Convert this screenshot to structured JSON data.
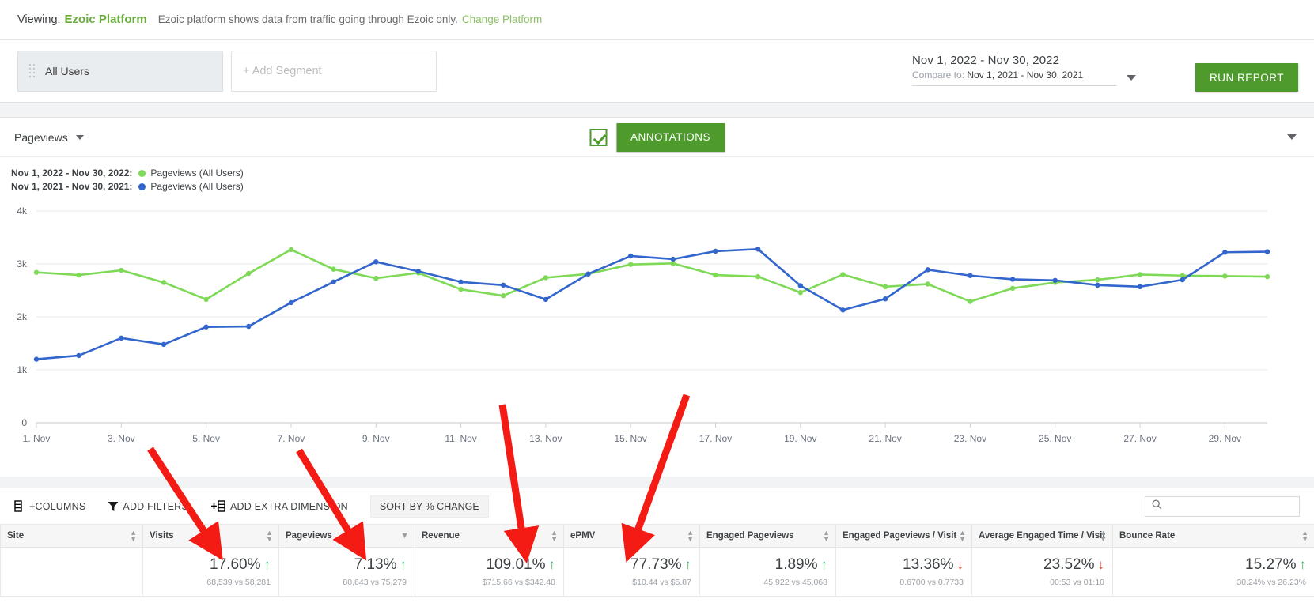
{
  "viewing": {
    "label": "Viewing:",
    "platform": "Ezoic Platform",
    "description": "Ezoic platform shows data from traffic going through Ezoic only.",
    "change_link": "Change Platform"
  },
  "segments": {
    "active": "All Users",
    "add_placeholder": "+ Add Segment"
  },
  "daterange": {
    "primary": "Nov 1, 2022 - Nov 30, 2022",
    "compare_label": "Compare to:",
    "compare_value": "Nov 1, 2021 - Nov 30, 2021"
  },
  "actions": {
    "run_report": "RUN REPORT",
    "annotations": "ANNOTATIONS"
  },
  "chart_toolbar": {
    "metric": "Pageviews"
  },
  "legend": [
    {
      "range": "Nov 1, 2022 - Nov 30, 2022:",
      "series": "Pageviews (All Users)",
      "color": "#7ed957"
    },
    {
      "range": "Nov 1, 2021 - Nov 30, 2021:",
      "series": "Pageviews (All Users)",
      "color": "#3366cc"
    }
  ],
  "table_toolbar": {
    "columns": "+COLUMNS",
    "add_filters": "ADD FILTERS",
    "add_extra_dimension": "ADD EXTRA DIMENSION",
    "sort_by_change": "SORT BY % CHANGE",
    "search_placeholder": ""
  },
  "table": {
    "columns": [
      "Site",
      "Visits",
      "Pageviews",
      "Revenue",
      "ePMV",
      "Engaged Pageviews",
      "Engaged Pageviews / Visit",
      "Average Engaged Time / Visit",
      "Bounce Rate"
    ],
    "rows": [
      {
        "site": "",
        "cells": [
          {
            "pct": "17.60%",
            "dir": "up",
            "sub": "68,539 vs 58,281"
          },
          {
            "pct": "7.13%",
            "dir": "up",
            "sub": "80,643 vs 75,279"
          },
          {
            "pct": "109.01%",
            "dir": "up",
            "sub": "$715.66 vs $342.40"
          },
          {
            "pct": "77.73%",
            "dir": "up",
            "sub": "$10.44 vs $5.87"
          },
          {
            "pct": "1.89%",
            "dir": "up",
            "sub": "45,922 vs 45,068"
          },
          {
            "pct": "13.36%",
            "dir": "down",
            "sub": "0.6700 vs 0.7733"
          },
          {
            "pct": "23.52%",
            "dir": "down",
            "sub": "00:53 vs 01:10"
          },
          {
            "pct": "15.27%",
            "dir": "up",
            "sub": "30.24% vs 26.23%"
          }
        ]
      }
    ]
  },
  "chart_data": {
    "type": "line",
    "title": "",
    "xlabel": "",
    "ylabel": "Pageviews",
    "ylim": [
      0,
      4000
    ],
    "yticks": [
      0,
      1000,
      2000,
      3000,
      4000
    ],
    "ytick_labels": [
      "0",
      "1k",
      "2k",
      "3k",
      "4k"
    ],
    "grid": true,
    "legend_position": "top-left",
    "x": [
      "1. Nov",
      "2. Nov",
      "3. Nov",
      "4. Nov",
      "5. Nov",
      "6. Nov",
      "7. Nov",
      "8. Nov",
      "9. Nov",
      "10. Nov",
      "11. Nov",
      "12. Nov",
      "13. Nov",
      "14. Nov",
      "15. Nov",
      "16. Nov",
      "17. Nov",
      "18. Nov",
      "19. Nov",
      "20. Nov",
      "21. Nov",
      "22. Nov",
      "23. Nov",
      "24. Nov",
      "25. Nov",
      "26. Nov",
      "27. Nov",
      "28. Nov",
      "29. Nov",
      "30. Nov"
    ],
    "xtick_labels": [
      "1. Nov",
      "3. Nov",
      "5. Nov",
      "7. Nov",
      "9. Nov",
      "11. Nov",
      "13. Nov",
      "15. Nov",
      "17. Nov",
      "19. Nov",
      "21. Nov",
      "23. Nov",
      "25. Nov",
      "27. Nov",
      "29. Nov"
    ],
    "series": [
      {
        "name": "Pageviews (All Users)",
        "period": "Nov 1, 2022 - Nov 30, 2022",
        "color": "#7ed957",
        "values": [
          2840,
          2790,
          2880,
          2650,
          2330,
          2820,
          3270,
          2900,
          2730,
          2830,
          2520,
          2400,
          2740,
          2810,
          2990,
          3010,
          2790,
          2760,
          2460,
          2800,
          2570,
          2620,
          2290,
          2540,
          2650,
          2700,
          2800,
          2780,
          2770,
          2760
        ]
      },
      {
        "name": "Pageviews (All Users)",
        "period": "Nov 1, 2021 - Nov 30, 2021",
        "color": "#3366cc",
        "values": [
          1200,
          1270,
          1600,
          1480,
          1810,
          1820,
          2270,
          2660,
          3040,
          2860,
          2660,
          2600,
          2330,
          2810,
          3150,
          3090,
          3240,
          3280,
          2590,
          2130,
          2340,
          2890,
          2780,
          2710,
          2690,
          2600,
          2570,
          2700,
          3220,
          3230
        ]
      }
    ]
  }
}
